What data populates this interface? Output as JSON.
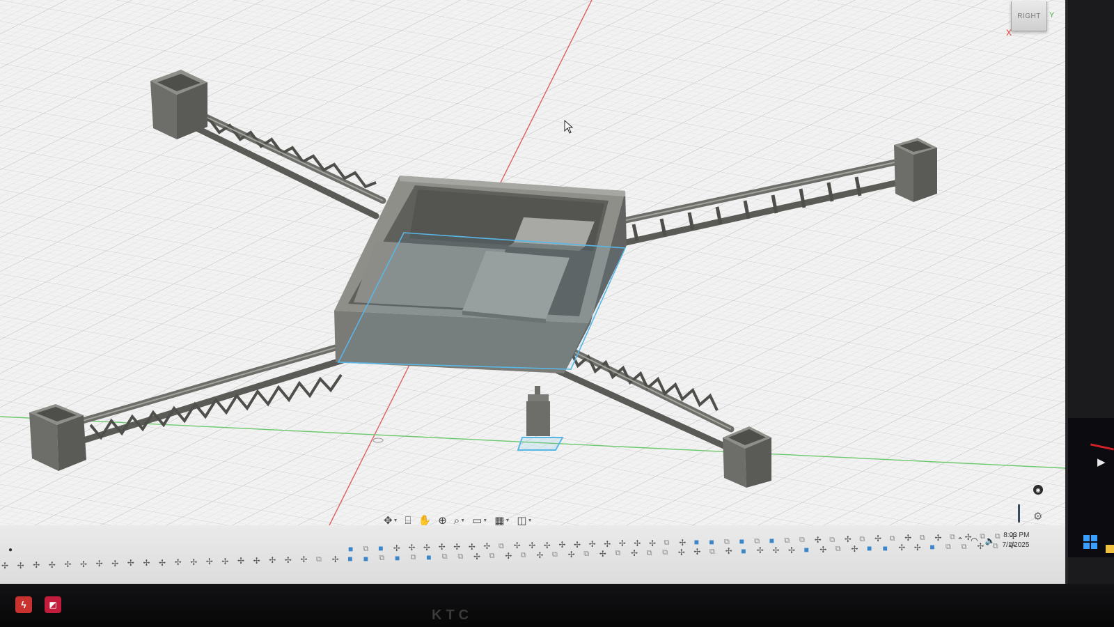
{
  "viewport": {
    "viewcube_label": "RIGHT",
    "axis_x_label": "X",
    "axis_y_label": "Y",
    "corner_icon": "compass-icon"
  },
  "colors": {
    "background": "#f2f2f2",
    "grid_minor": "#dcdcdc",
    "grid_major": "#c6c6c6",
    "model_top": "#8f8f8a",
    "model_side": "#6d6d69",
    "model_dark": "#4e4e4b",
    "selection": "#59b7e6",
    "x_axis": "#e06060",
    "y_axis": "#6cc86c"
  },
  "nav_toolbar": {
    "items": [
      {
        "name": "orbit",
        "glyph": "✥",
        "dropdown": true
      },
      {
        "name": "look-at",
        "glyph": "⌸",
        "dropdown": false
      },
      {
        "name": "pan",
        "glyph": "✋",
        "dropdown": false
      },
      {
        "name": "zoom",
        "glyph": "⊕",
        "dropdown": false
      },
      {
        "name": "fit",
        "glyph": "⌕",
        "dropdown": true
      },
      {
        "name": "display-settings",
        "glyph": "▭",
        "dropdown": true
      },
      {
        "name": "grid-settings",
        "glyph": "▦",
        "dropdown": true
      },
      {
        "name": "viewports",
        "glyph": "◫",
        "dropdown": true
      }
    ]
  },
  "timeline": {
    "marker_icon": "timeline-marker-icon",
    "settings_icon": "gear-icon",
    "row1_pattern": [
      "body",
      "sketch",
      "body",
      "plus",
      "plus",
      "plus",
      "plus",
      "plus",
      "plus",
      "plus",
      "sketch",
      "plus",
      "plus",
      "plus",
      "plus",
      "plus",
      "plus",
      "plus",
      "plus",
      "plus",
      "plus",
      "sketch",
      "plus",
      "body",
      "body",
      "sketch",
      "body",
      "sketch",
      "body",
      "sketch",
      "sketch",
      "plus",
      "sketch",
      "plus",
      "sketch",
      "plus",
      "sketch",
      "plus",
      "sketch",
      "plus",
      "sketch",
      "plus",
      "sketch",
      "sketch",
      "plus",
      "plus",
      "sketch",
      "plus",
      "body",
      "plus",
      "plus",
      "plus",
      "body",
      "plus",
      "sketch",
      "plus",
      "body",
      "body",
      "plus",
      "plus",
      "body",
      "sketch",
      "sketch",
      "plus",
      "sketch",
      "plus",
      "plus",
      "body"
    ],
    "row2_pattern": [
      "plus",
      "plus",
      "plus",
      "plus",
      "plus",
      "plus",
      "plus",
      "plus",
      "plus",
      "plus",
      "plus",
      "plus",
      "plus",
      "plus",
      "plus",
      "plus",
      "plus",
      "plus",
      "plus",
      "plus",
      "sketch",
      "plus",
      "body",
      "body",
      "sketch",
      "body",
      "sketch",
      "body",
      "sketch",
      "sketch",
      "plus",
      "sketch",
      "plus",
      "sketch",
      "plus",
      "sketch",
      "plus",
      "sketch",
      "plus",
      "sketch",
      "plus",
      "sketch",
      "sketch",
      "plus",
      "plus",
      "sketch",
      "plus",
      "body",
      "plus",
      "plus",
      "plus",
      "body",
      "plus",
      "sketch",
      "plus",
      "body",
      "body",
      "plus",
      "plus",
      "body",
      "sketch",
      "sketch",
      "plus",
      "sketch",
      "plus",
      "plus",
      "body",
      "body",
      "plus",
      "sketch",
      "plus",
      "sketch",
      "plus",
      "plus",
      "plus"
    ]
  },
  "tray": {
    "time": "8:03 PM",
    "date": "7/1/2025"
  },
  "taskbar": {
    "bezel_brand": "KTC"
  }
}
